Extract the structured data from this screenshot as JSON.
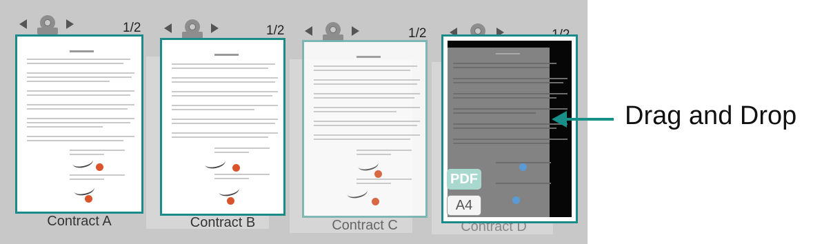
{
  "cards": [
    {
      "label": "Contract A",
      "page_count": "1/2"
    },
    {
      "label": "Contract B",
      "page_count": "1/2"
    },
    {
      "label": "Contract C",
      "page_count": "1/2"
    },
    {
      "label": "Contract D",
      "page_count": "1/2"
    }
  ],
  "badges": {
    "pdf": "PDF",
    "a4": "A4"
  },
  "hint": {
    "drag_text": "Drag and Drop"
  },
  "colors": {
    "accent": "#1b8a8a",
    "arrow": "#17908a",
    "stage": "#c8c8c8",
    "pdf_badge": "#a9d8cf"
  }
}
